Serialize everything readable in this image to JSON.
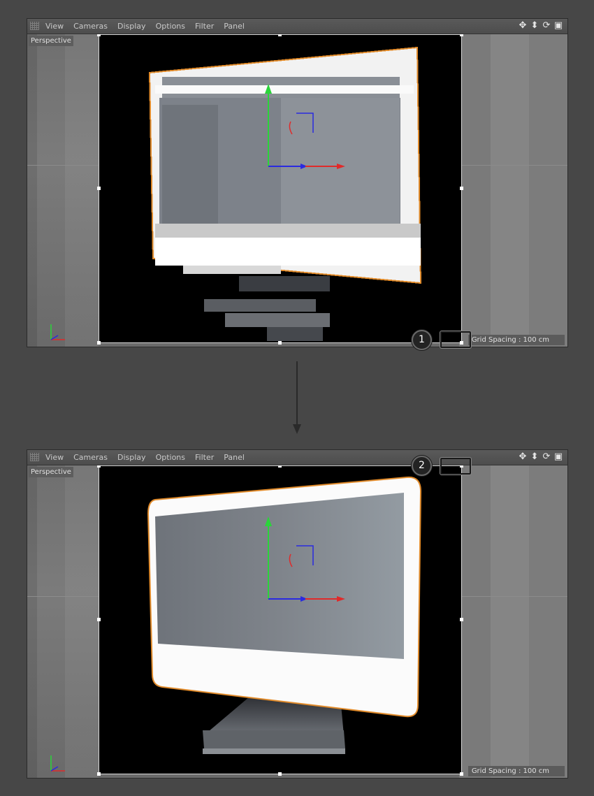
{
  "menu": [
    "View",
    "Cameras",
    "Display",
    "Options",
    "Filter",
    "Panel"
  ],
  "viewport_label": "Perspective",
  "grid_spacing": "Grid Spacing : 100 cm",
  "nav_icons": [
    "move-icon",
    "zoom-icon",
    "rotate-icon",
    "maximize-icon"
  ],
  "callouts": [
    "1",
    "2"
  ],
  "colors": {
    "selection": "#e08a2a",
    "axis_x": "#e02a2a",
    "axis_y": "#2ad43a",
    "axis_z": "#2a2ae0"
  }
}
